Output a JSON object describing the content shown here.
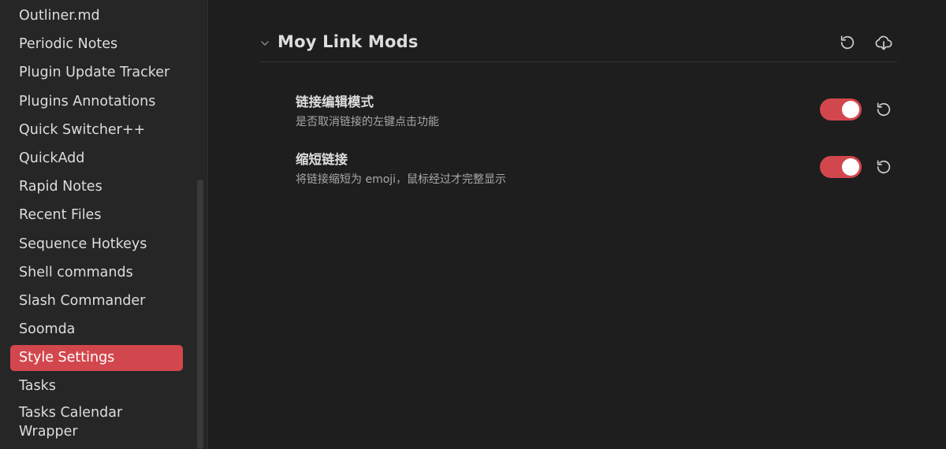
{
  "sidebar": {
    "items": [
      {
        "label": "Outliner.md",
        "active": false
      },
      {
        "label": "Periodic Notes",
        "active": false
      },
      {
        "label": "Plugin Update Tracker",
        "active": false
      },
      {
        "label": "Plugins Annotations",
        "active": false
      },
      {
        "label": "Quick Switcher++",
        "active": false
      },
      {
        "label": "QuickAdd",
        "active": false
      },
      {
        "label": "Rapid Notes",
        "active": false
      },
      {
        "label": "Recent Files",
        "active": false
      },
      {
        "label": "Sequence Hotkeys",
        "active": false
      },
      {
        "label": "Shell commands",
        "active": false
      },
      {
        "label": "Slash Commander",
        "active": false
      },
      {
        "label": "Soomda",
        "active": false
      },
      {
        "label": "Style Settings",
        "active": true
      },
      {
        "label": "Tasks",
        "active": false
      },
      {
        "label": "Tasks Calendar Wrapper",
        "active": false
      }
    ]
  },
  "section": {
    "title": "Moy Link Mods",
    "icons": {
      "collapse": "chevron-down-icon",
      "reset": "reset-icon",
      "export": "cloud-download-icon"
    }
  },
  "settings": [
    {
      "name": "链接编辑模式",
      "description": "是否取消链接的左键点击功能",
      "enabled": true
    },
    {
      "name": "缩短链接",
      "description": "将链接缩短为 emoji，鼠标经过才完整显示",
      "enabled": true
    }
  ],
  "colors": {
    "accent": "#d2474d",
    "background": "#1e1e1e",
    "sidebar": "#262626",
    "text": "#dcddde",
    "muted": "#a8a8a8"
  }
}
